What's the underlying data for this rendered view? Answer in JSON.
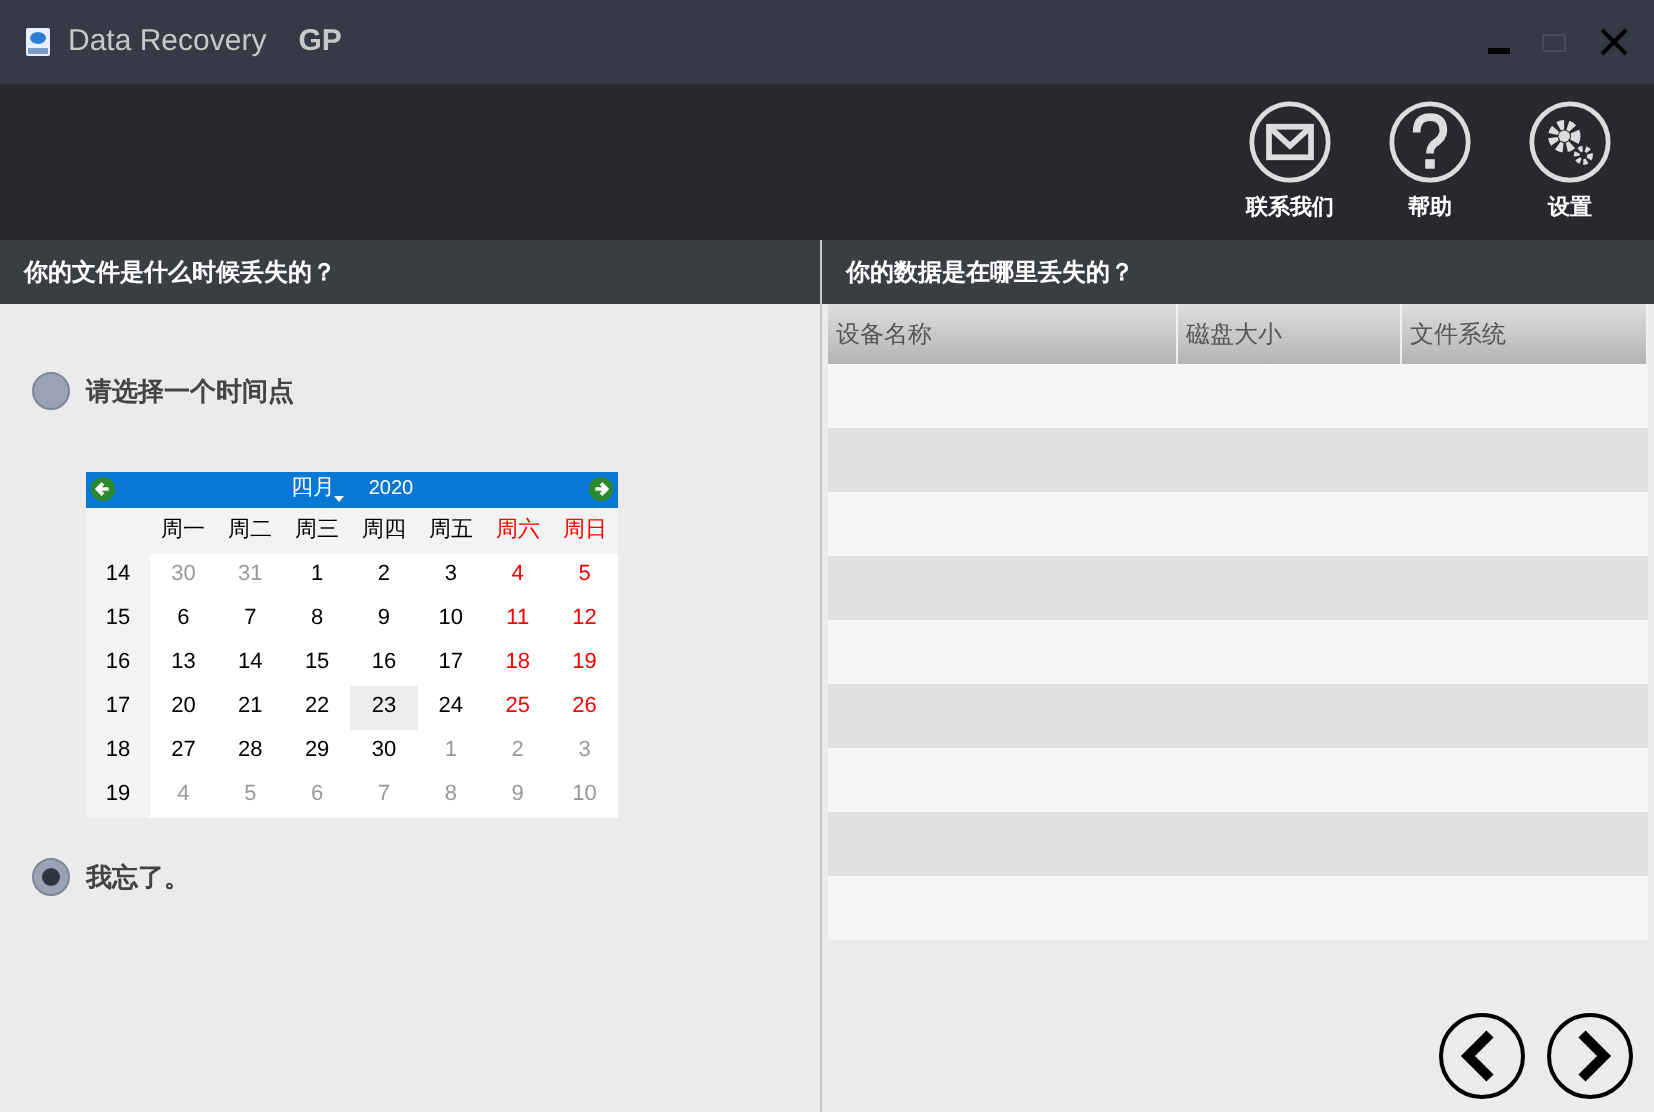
{
  "window": {
    "title": "Data Recovery",
    "title_suffix": "GP"
  },
  "toolbar": [
    {
      "label": "联系我们",
      "kind": "mail"
    },
    {
      "label": "帮助",
      "kind": "help"
    },
    {
      "label": "设置",
      "kind": "settings"
    }
  ],
  "left_panel": {
    "heading": "你的文件是什么时候丢失的？",
    "options": [
      {
        "label": "请选择一个时间点",
        "selected": false
      },
      {
        "label": "我忘了。",
        "selected": true
      }
    ],
    "calendar": {
      "month": "四月",
      "year": "2020",
      "weekdays": [
        {
          "text": "周一",
          "weekend": false
        },
        {
          "text": "周二",
          "weekend": false
        },
        {
          "text": "周三",
          "weekend": false
        },
        {
          "text": "周四",
          "weekend": false
        },
        {
          "text": "周五",
          "weekend": false
        },
        {
          "text": "周六",
          "weekend": true
        },
        {
          "text": "周日",
          "weekend": true
        }
      ],
      "weeks": [
        {
          "week": "14",
          "days": [
            {
              "text": "30",
              "kind": "other",
              "selected": false
            },
            {
              "text": "31",
              "kind": "other",
              "selected": false
            },
            {
              "text": "1",
              "kind": "day",
              "selected": false
            },
            {
              "text": "2",
              "kind": "day",
              "selected": false
            },
            {
              "text": "3",
              "kind": "day",
              "selected": false
            },
            {
              "text": "4",
              "kind": "weekend",
              "selected": false
            },
            {
              "text": "5",
              "kind": "weekend",
              "selected": false
            }
          ]
        },
        {
          "week": "15",
          "days": [
            {
              "text": "6",
              "kind": "day",
              "selected": false
            },
            {
              "text": "7",
              "kind": "day",
              "selected": false
            },
            {
              "text": "8",
              "kind": "day",
              "selected": false
            },
            {
              "text": "9",
              "kind": "day",
              "selected": false
            },
            {
              "text": "10",
              "kind": "day",
              "selected": false
            },
            {
              "text": "11",
              "kind": "weekend",
              "selected": false
            },
            {
              "text": "12",
              "kind": "weekend",
              "selected": false
            }
          ]
        },
        {
          "week": "16",
          "days": [
            {
              "text": "13",
              "kind": "day",
              "selected": false
            },
            {
              "text": "14",
              "kind": "day",
              "selected": false
            },
            {
              "text": "15",
              "kind": "day",
              "selected": false
            },
            {
              "text": "16",
              "kind": "day",
              "selected": false
            },
            {
              "text": "17",
              "kind": "day",
              "selected": false
            },
            {
              "text": "18",
              "kind": "weekend",
              "selected": false
            },
            {
              "text": "19",
              "kind": "weekend",
              "selected": false
            }
          ]
        },
        {
          "week": "17",
          "days": [
            {
              "text": "20",
              "kind": "day",
              "selected": false
            },
            {
              "text": "21",
              "kind": "day",
              "selected": false
            },
            {
              "text": "22",
              "kind": "day",
              "selected": false
            },
            {
              "text": "23",
              "kind": "day",
              "selected": true
            },
            {
              "text": "24",
              "kind": "day",
              "selected": false
            },
            {
              "text": "25",
              "kind": "weekend",
              "selected": false
            },
            {
              "text": "26",
              "kind": "weekend",
              "selected": false
            }
          ]
        },
        {
          "week": "18",
          "days": [
            {
              "text": "27",
              "kind": "day",
              "selected": false
            },
            {
              "text": "28",
              "kind": "day",
              "selected": false
            },
            {
              "text": "29",
              "kind": "day",
              "selected": false
            },
            {
              "text": "30",
              "kind": "day",
              "selected": false
            },
            {
              "text": "1",
              "kind": "other",
              "selected": false
            },
            {
              "text": "2",
              "kind": "other",
              "selected": false
            },
            {
              "text": "3",
              "kind": "other",
              "selected": false
            }
          ]
        },
        {
          "week": "19",
          "days": [
            {
              "text": "4",
              "kind": "other",
              "selected": false
            },
            {
              "text": "5",
              "kind": "other",
              "selected": false
            },
            {
              "text": "6",
              "kind": "other",
              "selected": false
            },
            {
              "text": "7",
              "kind": "other",
              "selected": false
            },
            {
              "text": "8",
              "kind": "other",
              "selected": false
            },
            {
              "text": "9",
              "kind": "other",
              "selected": false
            },
            {
              "text": "10",
              "kind": "other",
              "selected": false
            }
          ]
        }
      ]
    }
  },
  "right_panel": {
    "heading": "你的数据是在哪里丢失的？",
    "table": {
      "columns": [
        "设备名称",
        "磁盘大小",
        "文件系统"
      ]
    }
  }
}
